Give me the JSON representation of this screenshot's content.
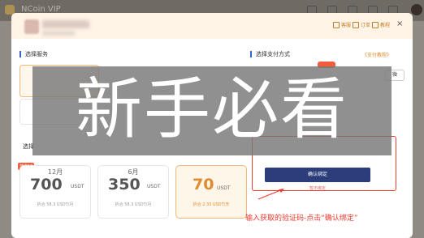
{
  "app": {
    "brand": "NCoin VIP"
  },
  "header": {
    "links": [
      {
        "label": "客服",
        "icon": "headset-icon"
      },
      {
        "label": "订单",
        "icon": "order-icon"
      },
      {
        "label": "教程",
        "icon": "book-icon"
      }
    ],
    "close": "×"
  },
  "service_section": {
    "title": "选择服务"
  },
  "payment_section": {
    "title": "选择支付方式",
    "tutorial_link": "《支付教程》",
    "chip": "微"
  },
  "plan_section": {
    "title_stub": "选择",
    "promo": "节省18"
  },
  "plans": [
    {
      "period": "12月",
      "price": "700",
      "unit": "USDT",
      "sub": "折合 58.3 USDT/月"
    },
    {
      "period": "6月",
      "price": "350",
      "unit": "USDT",
      "sub": "折合 58.3 USDT/月"
    },
    {
      "period": "",
      "price": "70",
      "unit": "USDT",
      "sub": "折合 2.33 USDT/天"
    }
  ],
  "selected_plan_index": 2,
  "bind": {
    "confirm_label": "确认绑定",
    "cancel_label": "暂不绑定"
  },
  "hint": "输入获取的验证码-点击“确认绑定”",
  "banner": "新手必看",
  "colors": {
    "accent": "#e08b2e",
    "confirm": "#2b3d7a",
    "annotation": "#ef3b2f",
    "section_bar": "#2e64d8"
  }
}
